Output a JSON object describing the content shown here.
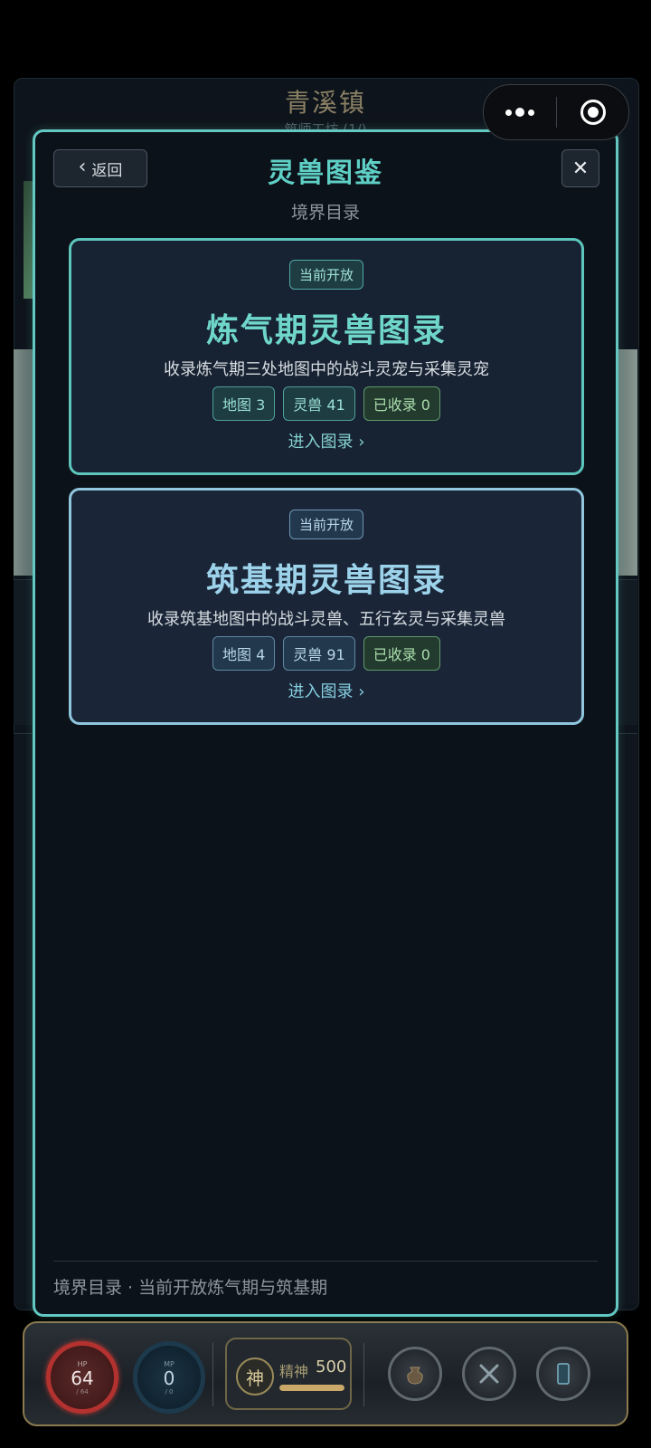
{
  "background": {
    "town_title": "青溪镇",
    "subtitle": "筑师工坊 (1/)"
  },
  "capsule": {
    "more_icon": "more-dots-icon",
    "target_icon": "target-circle-icon"
  },
  "modal": {
    "back_label": "返回",
    "title": "灵兽图鉴",
    "close_glyph": "✕",
    "subtitle": "境界目录",
    "cards": [
      {
        "badge": "当前开放",
        "title": "炼气期灵兽图录",
        "description": "收录炼气期三处地图中的战斗灵宠与采集灵宠",
        "tags": [
          "地图 3",
          "灵兽 41",
          "已收录 0"
        ],
        "enter_label": "进入图录 ›"
      },
      {
        "badge": "当前开放",
        "title": "筑基期灵兽图录",
        "description": "收录筑基地图中的战斗灵兽、五行玄灵与采集灵兽",
        "tags": [
          "地图 4",
          "灵兽 91",
          "已收录 0"
        ],
        "enter_label": "进入图录 ›"
      }
    ],
    "footer": "境界目录 · 当前开放炼气期与筑基期"
  },
  "hud": {
    "hp": {
      "label": "HP",
      "value": "64",
      "max": "/ 64"
    },
    "mp": {
      "label": "MP",
      "value": "0",
      "max": "/ 0"
    },
    "spirit": {
      "seal": "神",
      "label": "精神",
      "value": "500",
      "fill_percent": 100
    },
    "buttons": [
      "bag-icon",
      "swords-icon",
      "phone-icon"
    ]
  },
  "colors": {
    "accent": "#5fd0c6",
    "hp": "#b3322f",
    "gold": "#c9a86a"
  }
}
